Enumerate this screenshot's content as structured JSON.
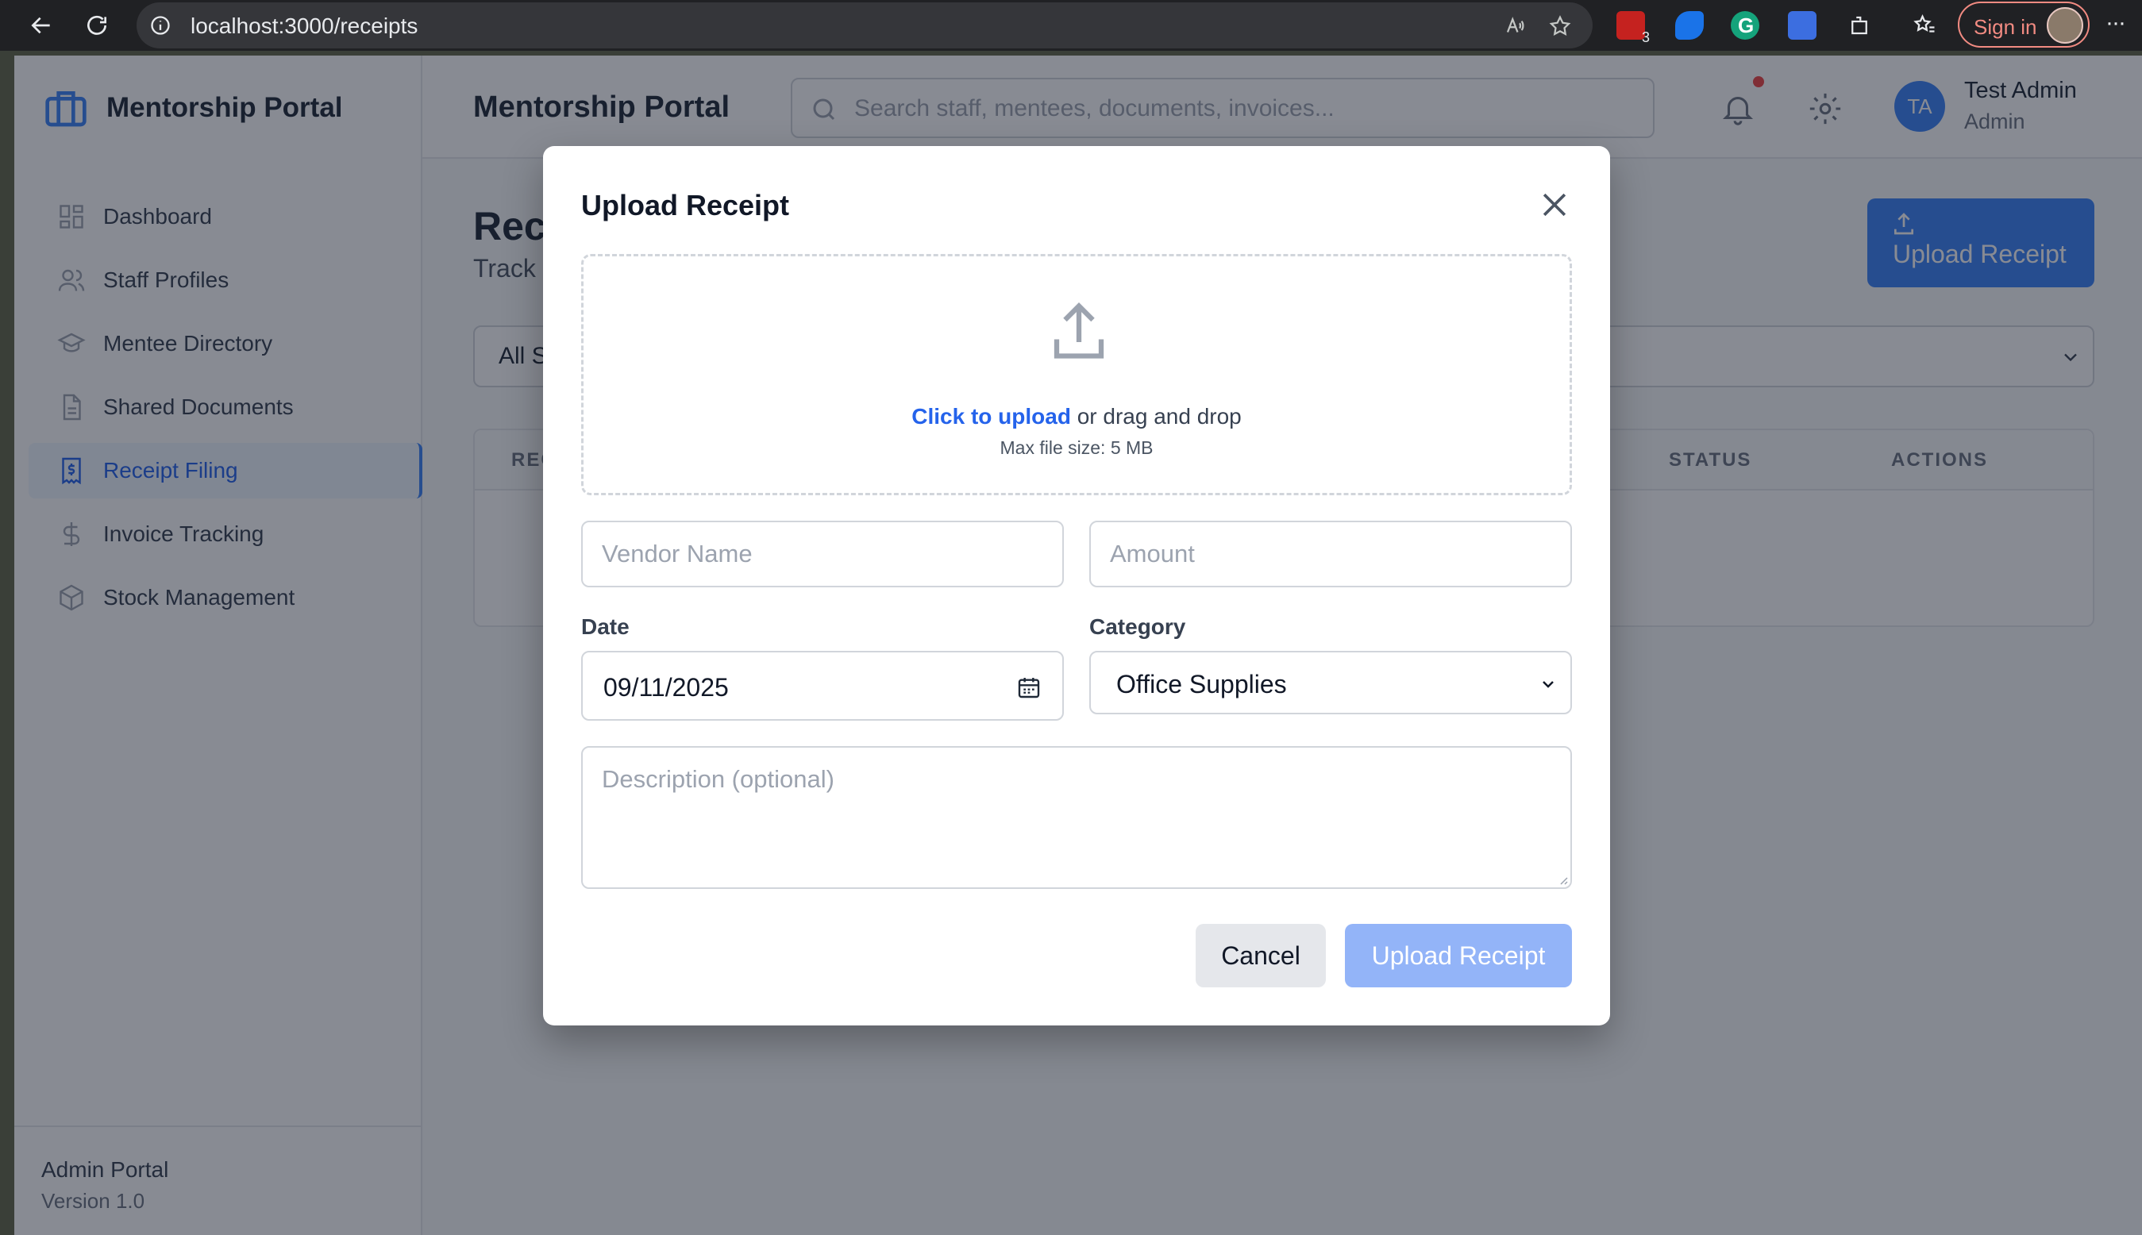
{
  "browser": {
    "url": "localhost:3000/receipts",
    "sign_in_label": "Sign in",
    "extension_badge": "3",
    "icons": [
      "back-icon",
      "reload-icon",
      "site-info-icon",
      "read-aloud-icon",
      "favorite-star-icon",
      "extension-icon",
      "favorites-icon",
      "more-icon"
    ]
  },
  "sidebar": {
    "brand": "Mentorship Portal",
    "items": [
      {
        "label": "Dashboard",
        "icon": "dashboard-icon"
      },
      {
        "label": "Staff Profiles",
        "icon": "users-icon"
      },
      {
        "label": "Mentee Directory",
        "icon": "graduation-cap-icon"
      },
      {
        "label": "Shared Documents",
        "icon": "document-icon"
      },
      {
        "label": "Receipt Filing",
        "icon": "receipt-icon",
        "active": true
      },
      {
        "label": "Invoice Tracking",
        "icon": "dollar-icon"
      },
      {
        "label": "Stock Management",
        "icon": "cube-icon"
      }
    ],
    "footer_title": "Admin Portal",
    "footer_version": "Version 1.0"
  },
  "header": {
    "title": "Mentorship Portal",
    "search_placeholder": "Search staff, mentees, documents, invoices...",
    "user_initials": "TA",
    "user_name": "Test Admin",
    "user_role": "Admin"
  },
  "page": {
    "title_visible": "Rec",
    "subtitle_visible": "Track",
    "upload_button": "Upload Receipt",
    "filter_visible": "All S",
    "table_headers": {
      "first_visible": "REC",
      "status": "STATUS",
      "actions": "ACTIONS"
    }
  },
  "modal": {
    "title": "Upload Receipt",
    "dropzone": {
      "link_text": "Click to upload",
      "rest_text": " or drag and drop",
      "max_size": "Max file size: 5 MB"
    },
    "vendor_placeholder": "Vendor Name",
    "amount_placeholder": "Amount",
    "date_label": "Date",
    "date_value": "09/11/2025",
    "category_label": "Category",
    "category_value": "Office Supplies",
    "description_placeholder": "Description (optional)",
    "cancel_label": "Cancel",
    "submit_label": "Upload Receipt"
  },
  "colors": {
    "accent": "#3b82f6",
    "link": "#2563eb",
    "submit_disabled": "#93b4f8",
    "notification_dot": "#ef4444"
  }
}
